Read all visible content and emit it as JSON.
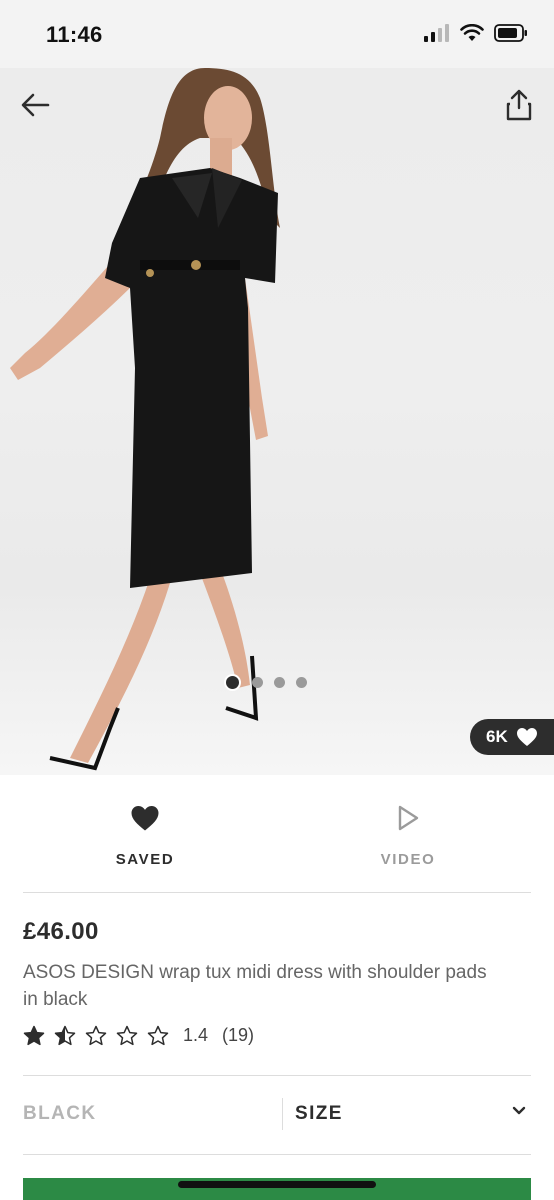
{
  "status_bar": {
    "time": "11:46"
  },
  "gallery": {
    "image_count": 4,
    "active_index": 0
  },
  "saves": {
    "count": "6K"
  },
  "actions": {
    "saved_label": "SAVED",
    "video_label": "VIDEO"
  },
  "product": {
    "price": "£46.00",
    "title": "ASOS DESIGN wrap tux midi dress with shoulder pads in black",
    "rating": {
      "value": "1.4",
      "count": "(19)",
      "stars": 1.4,
      "max": 5
    }
  },
  "options": {
    "colour": "BLACK",
    "size_label": "SIZE"
  },
  "colors": {
    "accent_green": "#2c8a45",
    "text_dark": "#2d2d2d",
    "text_muted": "#9b9b9b"
  },
  "icons": {
    "back": "arrow-left-icon",
    "share": "share-icon",
    "save": "heart-icon",
    "video": "play-icon",
    "dropdown": "chevron-down-icon"
  }
}
